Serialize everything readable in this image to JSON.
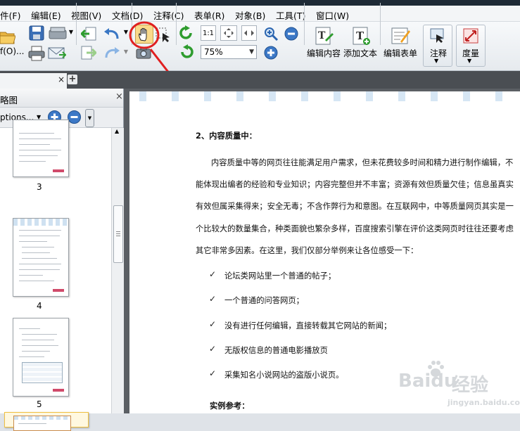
{
  "menu": {
    "file": "件(F)",
    "edit": "编辑(E)",
    "view": "视图(V)",
    "document": "文档(D)",
    "comment": "注释(C)",
    "form": "表单(R)",
    "object": "对象(B)",
    "tools": "工具(T)",
    "window": "窗口(W)"
  },
  "toolbar": {
    "open_label": "f(O)...",
    "zoom_value": "75%",
    "fit_label": "1:1",
    "edit_content": "编辑内容",
    "add_text": "添加文本",
    "edit_form": "编辑表单",
    "comment": "注释",
    "measure": "度量"
  },
  "tabs": {
    "close_glyph": "×",
    "add_glyph": "+"
  },
  "panel": {
    "title": "略图",
    "options_label": "ptions...",
    "pages": [
      "3",
      "4",
      "5"
    ]
  },
  "document": {
    "heading": "2、内容质量中：",
    "para_lines": [
      "内容质量中等的网页往往能满足用户需求，但未花费较多时间和精力进行制作编辑，不",
      "能体现出编者的经验和专业知识；内容完整但并不丰富；资源有效但质量欠佳；信息虽真实",
      "有效但属采集得来；安全无毒；不含作弊行为和意图。在互联网中，中等质量网页其实是一",
      "个比较大的数量集合，种类面貌也繁杂多样，百度搜索引擎在评价这类网页时往往还要考虑",
      "其它非常多因素。在这里，我们仅部分举例来让各位感受一下："
    ],
    "check_glyph": "✓",
    "bullets": [
      "论坛类网站里一个普通的帖子；",
      "一个普通的问答网页；",
      "没有进行任何编辑，直接转载其它网站的新闻；",
      "无版权信息的普通电影播放页",
      "采集知名小说网站的盗版小说页。"
    ],
    "example_heading": "实例参考："
  },
  "watermark": {
    "brand": "Baidu",
    "suffix": "经验",
    "url": "jingyan.baidu.com"
  },
  "colors": {
    "annotation_red": "#e02020",
    "thumb_selected": "#f0c040"
  }
}
